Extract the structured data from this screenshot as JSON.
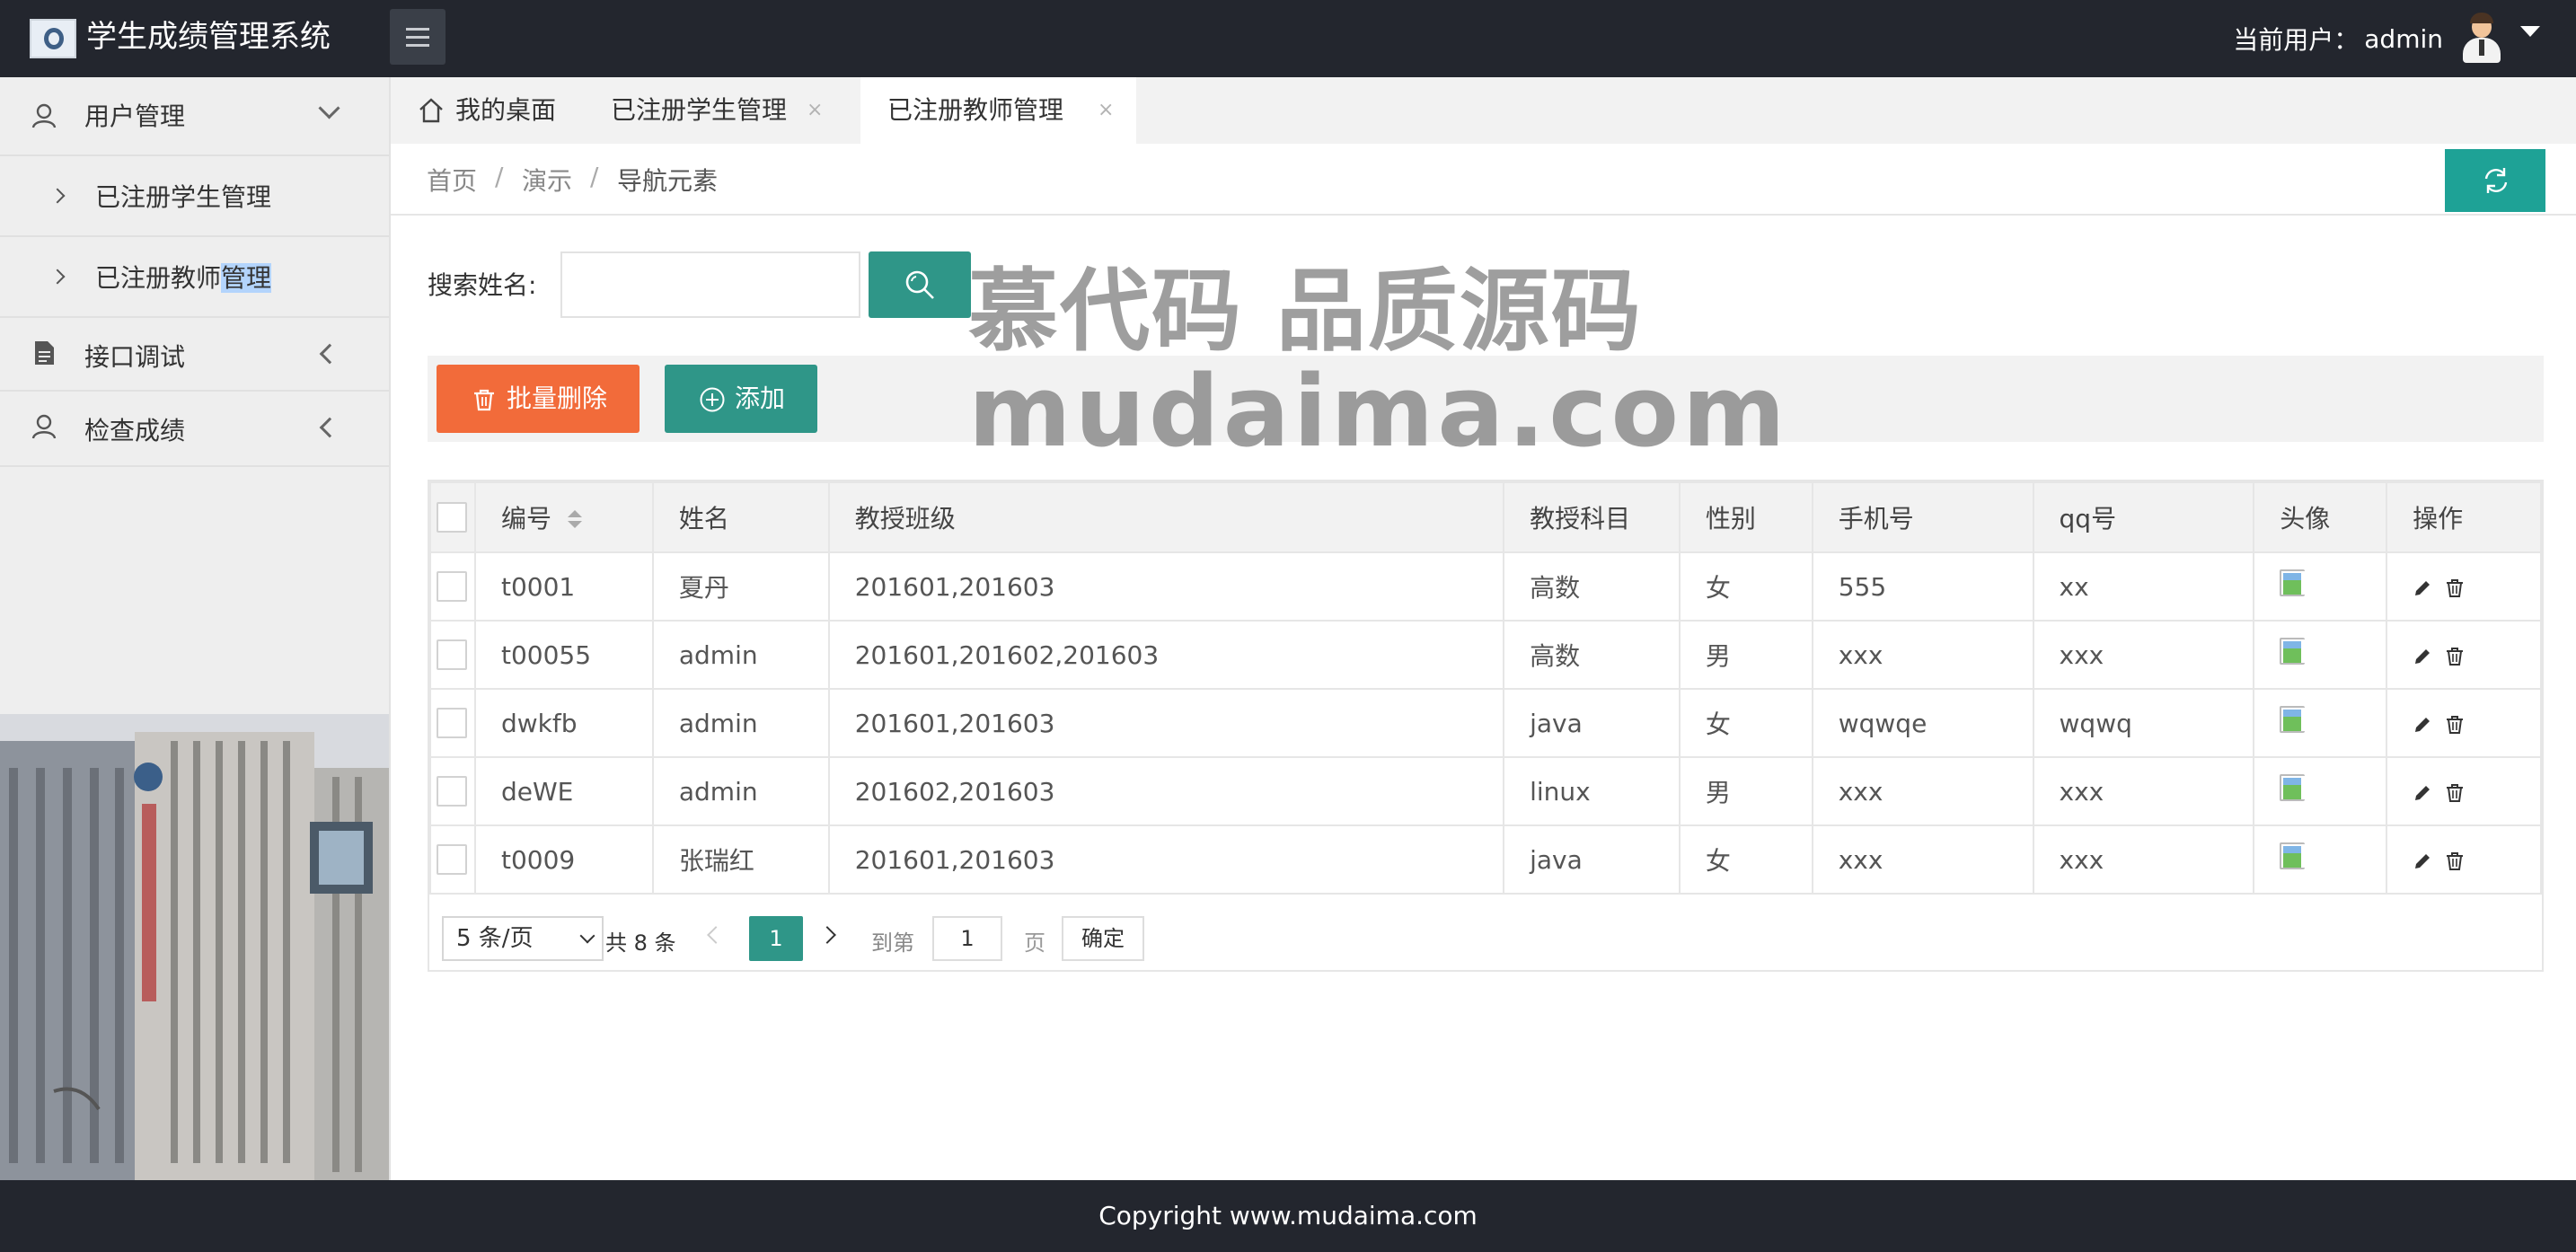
{
  "app": {
    "title": "学生成绩管理系统"
  },
  "header": {
    "user_label": "当前用户：",
    "user_name": "admin"
  },
  "sidebar": {
    "groups": [
      {
        "label": "用户管理",
        "expanded": true,
        "children": [
          "已注册学生管理",
          "已注册教师管理"
        ]
      },
      {
        "label": "接口调试",
        "expanded": false
      },
      {
        "label": "检查成绩",
        "expanded": false
      }
    ]
  },
  "tabs": [
    {
      "label": "我的桌面"
    },
    {
      "label": "已注册学生管理",
      "close": "×"
    },
    {
      "label": "已注册教师管理",
      "close": "×",
      "active": true
    }
  ],
  "breadcrumb": [
    "首页",
    "演示",
    "导航元素"
  ],
  "breadcrumb_sep": "/",
  "search": {
    "label": "搜索姓名:",
    "value": ""
  },
  "toolbar": {
    "delete_label": "批量删除",
    "add_label": "添加"
  },
  "table": {
    "headers": [
      "编号",
      "姓名",
      "教授班级",
      "教授科目",
      "性别",
      "手机号",
      "qq号",
      "头像",
      "操作"
    ],
    "rows": [
      [
        "t0001",
        "夏丹",
        "201601,201603",
        "高数",
        "女",
        "555",
        "xx"
      ],
      [
        "t00055",
        "admin",
        "201601,201602,201603",
        "高数",
        "男",
        "xxx",
        "xxx"
      ],
      [
        "dwkfb",
        "admin",
        "201601,201603",
        "java",
        "女",
        "wqwqe",
        "wqwq"
      ],
      [
        "deWE",
        "admin",
        "201602,201603",
        "linux",
        "男",
        "xxx",
        "xxx"
      ],
      [
        "t0009",
        "张瑞红",
        "201601,201603",
        "java",
        "女",
        "xxx",
        "xxx"
      ]
    ]
  },
  "pager": {
    "page_size": "5 条/页",
    "total": "共 8 条",
    "current_page": "1",
    "goto_label": "到第",
    "goto_value": "1",
    "page_word": "页",
    "confirm": "确定"
  },
  "footer": {
    "text": "Copyright www.mudaima.com"
  },
  "watermark": {
    "line1": "慕代码 品质源码",
    "line2": "mudaima.com"
  },
  "colors": {
    "accent": "#009688",
    "danger": "#f26b3a",
    "header_bg": "#23262e"
  }
}
